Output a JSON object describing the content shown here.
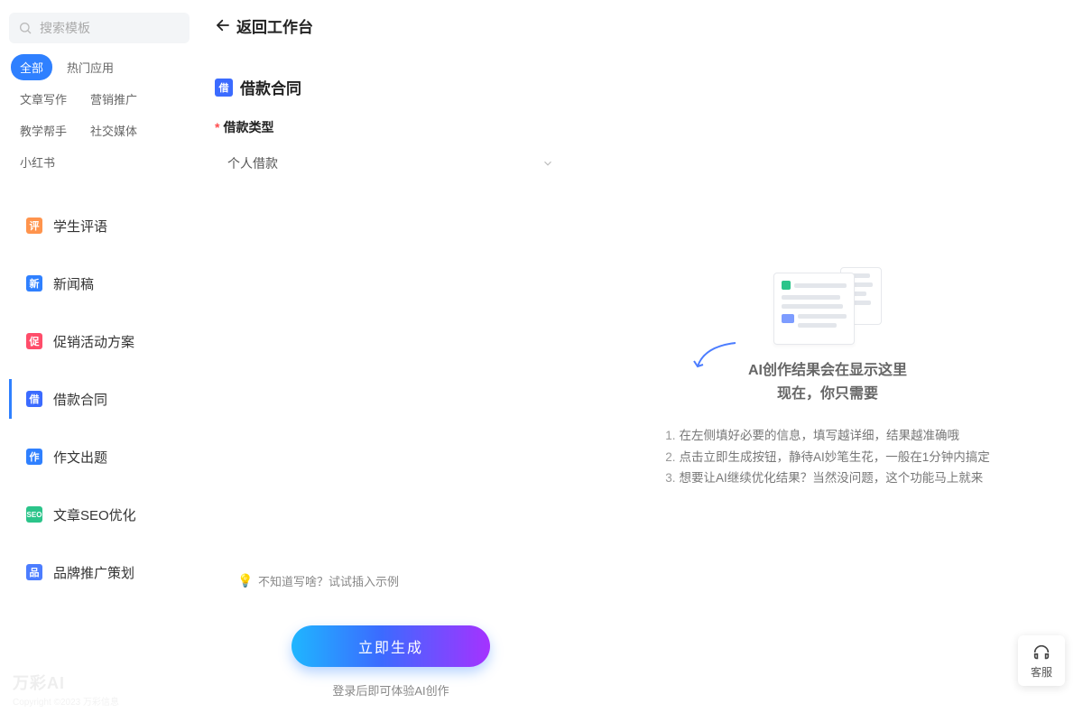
{
  "sidebar": {
    "search_placeholder": "搜索模板",
    "tags": [
      {
        "label": "全部",
        "active": true
      },
      {
        "label": "热门应用",
        "active": false
      },
      {
        "label": "文章写作",
        "active": false
      },
      {
        "label": "营销推广",
        "active": false
      },
      {
        "label": "教学帮手",
        "active": false
      },
      {
        "label": "社交媒体",
        "active": false
      },
      {
        "label": "小红书",
        "active": false
      }
    ],
    "nav": [
      {
        "label": "学生评语",
        "icon_bg": "#ff944d",
        "glyph": "评",
        "active": false
      },
      {
        "label": "新闻稿",
        "icon_bg": "#2f80ff",
        "glyph": "新",
        "active": false
      },
      {
        "label": "促销活动方案",
        "icon_bg": "#ff4d6a",
        "glyph": "促",
        "active": false
      },
      {
        "label": "借款合同",
        "icon_bg": "#3b6bff",
        "glyph": "借",
        "active": true
      },
      {
        "label": "作文出题",
        "icon_bg": "#2f80ff",
        "glyph": "作",
        "active": false
      },
      {
        "label": "文章SEO优化",
        "icon_bg": "#2bc48a",
        "glyph": "SEO",
        "active": false
      },
      {
        "label": "品牌推广策划",
        "icon_bg": "#4c7dff",
        "glyph": "品",
        "active": false
      }
    ],
    "watermark": "万彩AI",
    "watermark_sub": "Copyright ©2023 万彩信息"
  },
  "topbar": {
    "back_label": "返回工作台"
  },
  "form": {
    "title": "借款合同",
    "title_glyph": "借",
    "field_label": "借款类型",
    "required_mark": "*",
    "select_value": "个人借款",
    "example_hint": "不知道写啥？试试插入示例"
  },
  "action": {
    "generate_label": "立即生成",
    "login_hint": "登录后即可体验AI创作"
  },
  "result": {
    "title_line1": "AI创作结果会在显示这里",
    "title_line2": "现在，你只需要",
    "steps": [
      "在左侧填好必要的信息，填写越详细，结果越准确哦",
      "点击立即生成按钮，静待AI妙笔生花，一般在1分钟内搞定",
      "想要让AI继续优化结果？当然没问题，这个功能马上就来"
    ]
  },
  "support": {
    "label": "客服"
  }
}
